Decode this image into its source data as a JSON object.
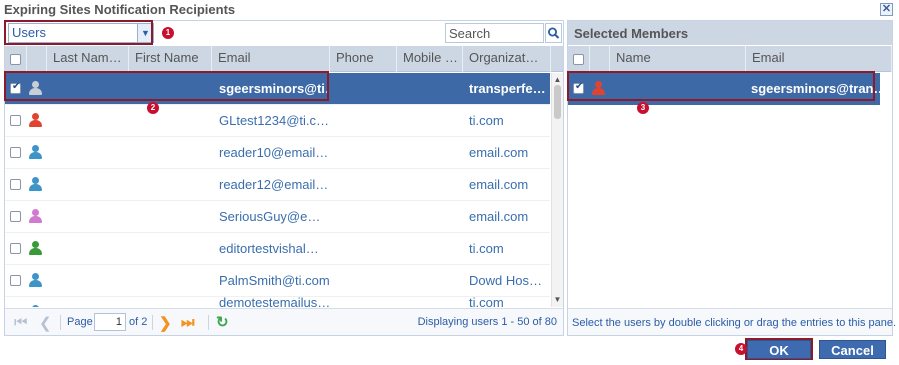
{
  "dialog": {
    "title": "Expiring Sites Notification Recipients",
    "close_icon": "close-icon"
  },
  "left": {
    "type_select": "Users",
    "search_placeholder": "Search",
    "columns": [
      "Last Nam…",
      "First Name",
      "Email",
      "Phone",
      "Mobile …",
      "Organizat…"
    ],
    "rows": [
      {
        "email": "sgeersminors@ti…",
        "org": "transperfe…",
        "selected": true,
        "icon_color": "#c8ced6"
      },
      {
        "email": "GLtest1234@ti.c…",
        "org": "ti.com",
        "selected": false,
        "icon_color": "#e0442f"
      },
      {
        "email": "reader10@email…",
        "org": "email.com",
        "selected": false,
        "icon_color": "#3d94c8"
      },
      {
        "email": "reader12@email…",
        "org": "email.com",
        "selected": false,
        "icon_color": "#3d94c8"
      },
      {
        "email": "SeriousGuy@e…",
        "org": "email.com",
        "selected": false,
        "icon_color": "#d07ad0"
      },
      {
        "email": "editortestvishal…",
        "org": "ti.com",
        "selected": false,
        "icon_color": "#3a9a3a"
      },
      {
        "email": "PalmSmith@ti.com",
        "org": "Dowd Hos…",
        "selected": false,
        "icon_color": "#3d94c8"
      },
      {
        "email": "demotestemailus…",
        "org": "ti.com",
        "selected": false,
        "icon_color": "#3d94c8"
      }
    ],
    "pager": {
      "page_label": "Page",
      "page_value": "1",
      "of_label": "of 2",
      "displaying": "Displaying users 1 - 50 of 80"
    }
  },
  "right": {
    "title": "Selected Members",
    "columns": [
      "Name",
      "Email"
    ],
    "rows": [
      {
        "email": "sgeersminors@tran…",
        "icon_color": "#e0442f"
      }
    ],
    "footer": "Select the users by double clicking or drag the entries to this pane."
  },
  "badges": [
    "1",
    "2",
    "3",
    "4"
  ],
  "buttons": {
    "ok": "OK",
    "cancel": "Cancel"
  },
  "colors": {
    "accent": "#3d6aa6",
    "annotation": "#8b1a2a",
    "badge": "#c8102e"
  }
}
